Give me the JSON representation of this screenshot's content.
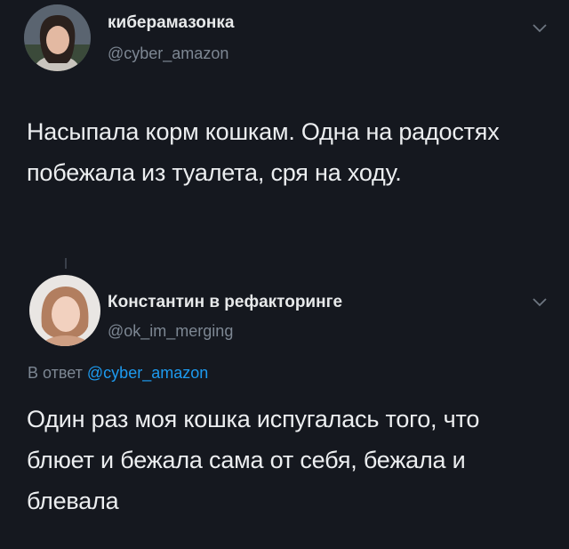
{
  "tweet1": {
    "display_name": "киберамазонка",
    "handle": "@cyber_amazon",
    "text": "Насыпала корм кошкам. Одна на радостях побежала из туалета, сря на ходу."
  },
  "tweet2": {
    "display_name": "Константин в рефакторинге",
    "handle": "@ok_im_merging",
    "reply_prefix": "В ответ",
    "reply_mention": "@cyber_amazon",
    "text": "Один раз моя кошка испугалась того, что блюет и бежала сама от себя, бежала и блевала"
  },
  "icons": {
    "menu": "chevron-down-icon"
  },
  "colors": {
    "background": "#15181f",
    "text": "#e7e9ea",
    "secondary": "#7d8793",
    "link": "#1d9bf0"
  }
}
